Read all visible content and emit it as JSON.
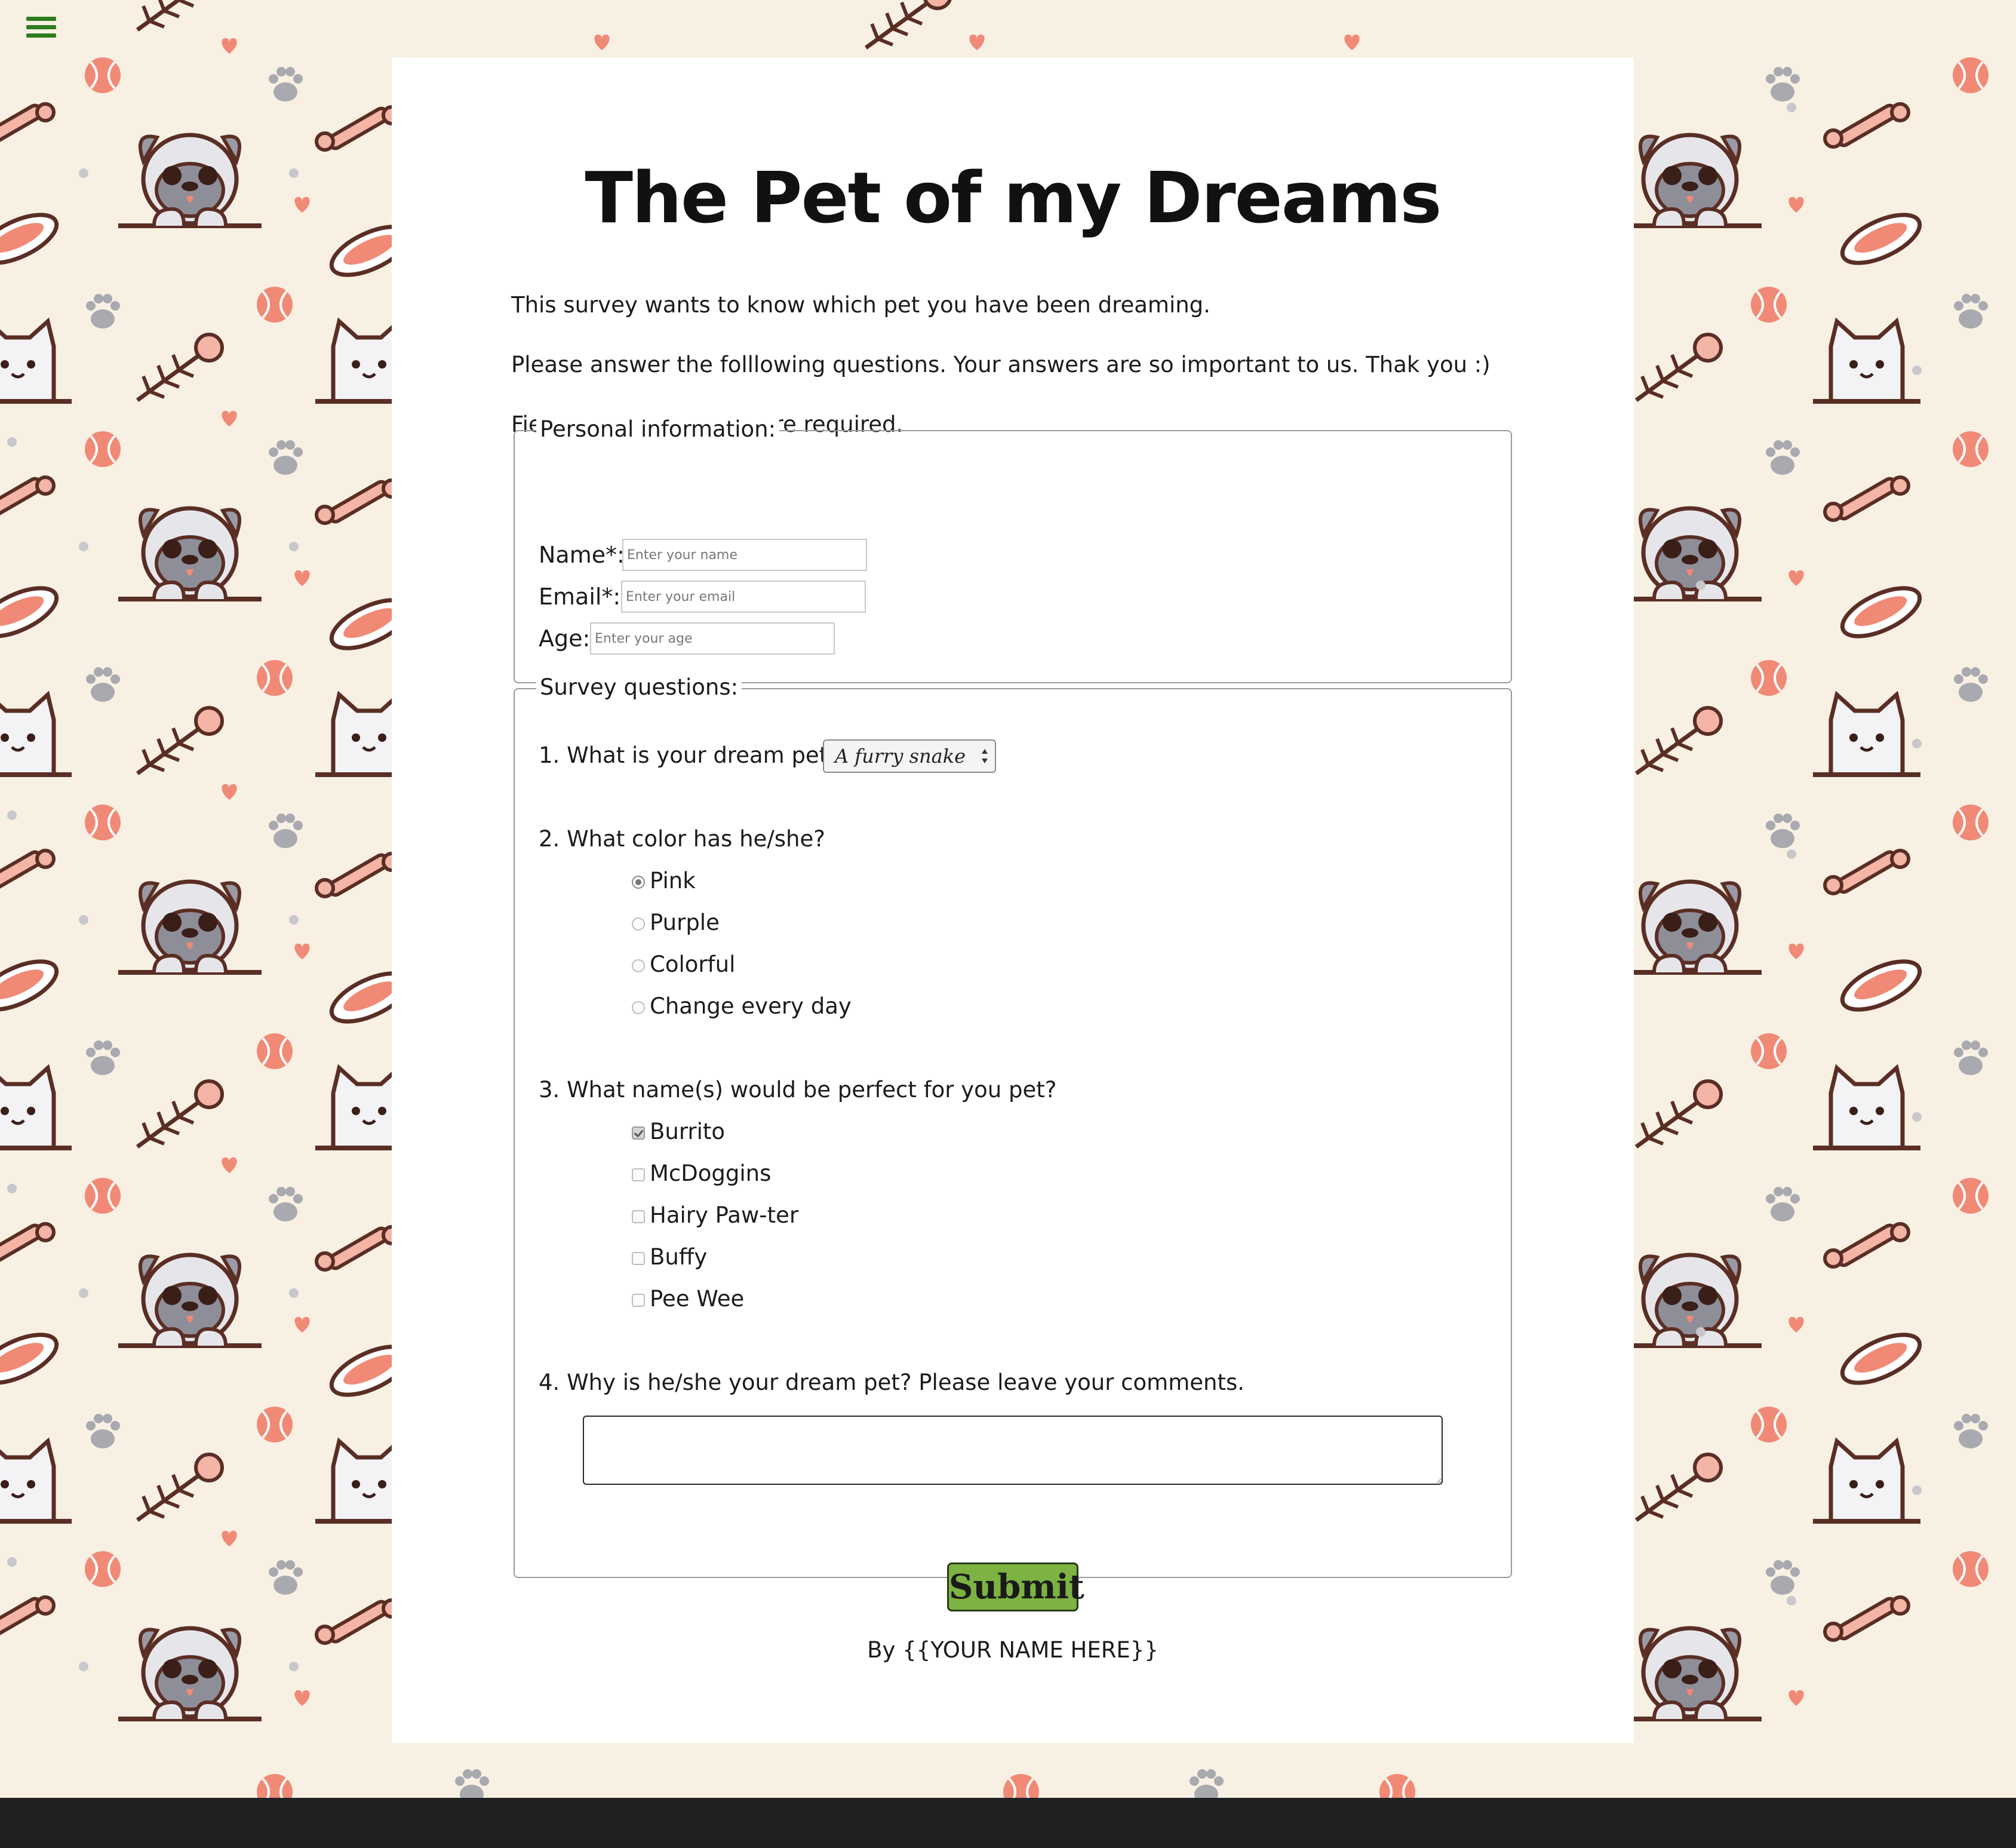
{
  "page": {
    "title": "The Pet of my Dreams",
    "intro": [
      "This survey wants to know which pet you have been dreaming.",
      "Please answer the folllowing questions. Your answers are so important to us. Thak you :)",
      "Fields marked with (*) are required."
    ],
    "byline": "By {{YOUR NAME HERE}}"
  },
  "personal": {
    "legend": "Personal information:",
    "name_label": "Name*:",
    "name_placeholder": "Enter your name",
    "email_label": "Email*:",
    "email_placeholder": "Enter your email",
    "age_label": "Age:",
    "age_placeholder": "Enter your age"
  },
  "survey": {
    "legend": "Survey questions:",
    "q1": "1. What is your dream pet?",
    "q1_selected": "A furry snake",
    "q2": "2. What color has he/she?",
    "q2_options": [
      "Pink",
      "Purple",
      "Colorful",
      "Change every day"
    ],
    "q2_selected": "Pink",
    "q3": "3. What name(s) would be perfect for you pet?",
    "q3_options": [
      "Burrito",
      "McDoggins",
      "Hairy Paw-ter",
      "Buffy",
      "Pee Wee"
    ],
    "q3_checked": [
      "Burrito"
    ],
    "q4": "4. Why is he/she your dream pet? Please leave your comments."
  },
  "actions": {
    "submit_label": "Submit"
  },
  "icons": {
    "menu": "hamburger-menu-icon",
    "select_arrows": "select-arrows-icon"
  },
  "colors": {
    "background": "#f8f0e3",
    "pattern_accent": "#f08a76",
    "pattern_outline": "#5a2e24",
    "menu_icon": "#2e7d1e",
    "submit_button": "#7cb342",
    "bottom_bar": "#1f2123"
  }
}
